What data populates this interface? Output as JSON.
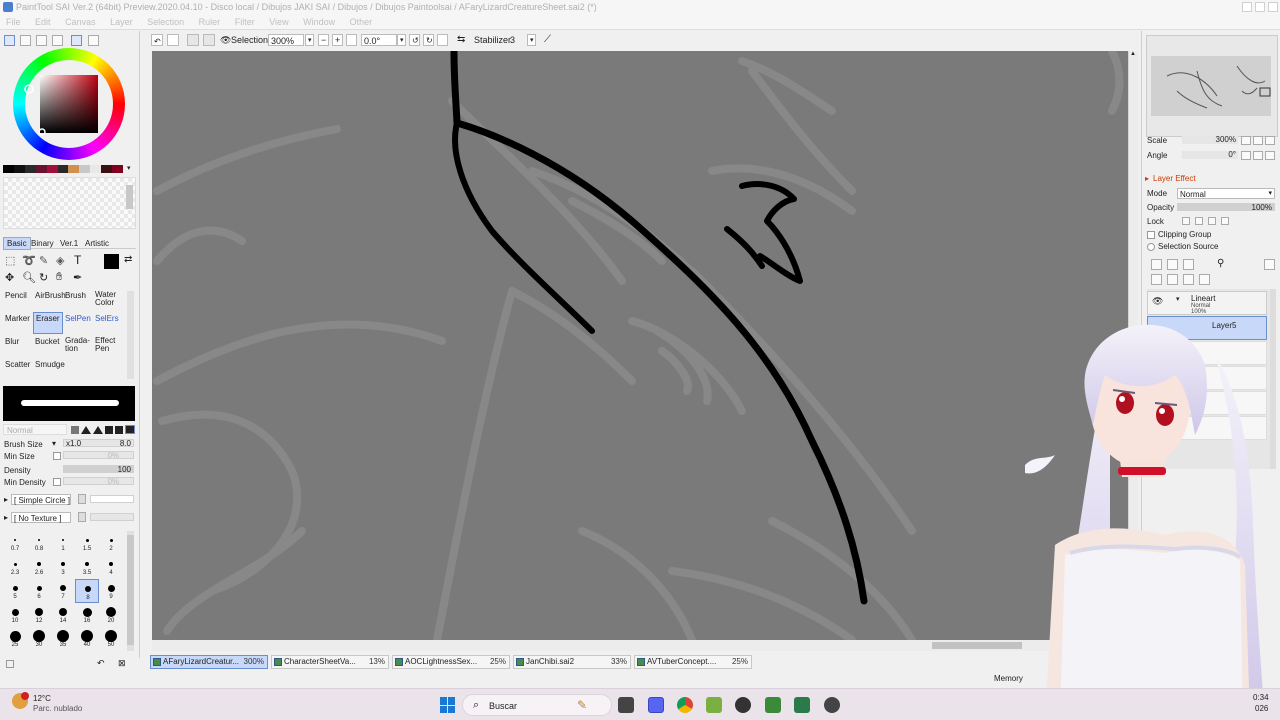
{
  "window": {
    "title": "PaintTool SAI Ver.2 (64bit) Preview.2020.04.10 - Disco local / Dibujos JAKI SAI / Dibujos / Dibujos Paintoolsai / AFaryLizardCreatureSheet.sai2 (*)"
  },
  "menu": [
    "File",
    "Edit",
    "Canvas",
    "Layer",
    "Selection",
    "Ruler",
    "Filter",
    "View",
    "Window",
    "Other"
  ],
  "toolbar": {
    "selection_label": "Selection",
    "zoom": "300%",
    "rotation": "0.0°",
    "stabilizer_label": "Stabilizer",
    "stabilizer_value": "3"
  },
  "left": {
    "tool_tabs": [
      "Basic",
      "Binary",
      "Ver.1",
      "Artistic"
    ],
    "tools": [
      {
        "label": "Pencil"
      },
      {
        "label": "AirBrush"
      },
      {
        "label": "Brush"
      },
      {
        "label": "Water Color"
      },
      {
        "label": "Marker"
      },
      {
        "label": "Eraser"
      },
      {
        "label": "SelPen"
      },
      {
        "label": "SelErs"
      },
      {
        "label": "Blur"
      },
      {
        "label": "Bucket"
      },
      {
        "label": "Grada- tion"
      },
      {
        "label": "Effect Pen"
      },
      {
        "label": "Scatter"
      },
      {
        "label": "Smudge"
      }
    ],
    "blend_mode": "Normal",
    "brush_size_label": "Brush Size",
    "brush_size_multiplier": "x1.0",
    "brush_size_value": "8.0",
    "min_size_label": "Min Size",
    "min_size_value": "0%",
    "density_label": "Density",
    "density_value": "100",
    "min_density_label": "Min Density",
    "min_density_value": "0%",
    "shape": "[ Simple Circle ]",
    "texture": "[ No Texture ]",
    "brush_sizes": [
      "0.7",
      "0.8",
      "1",
      "1.5",
      "2",
      "2.3",
      "2.6",
      "3",
      "3.5",
      "4",
      "5",
      "6",
      "7",
      "8",
      "9",
      "10",
      "12",
      "14",
      "16",
      "20",
      "25",
      "30",
      "35",
      "40",
      "50"
    ]
  },
  "right": {
    "scale_label": "Scale",
    "scale_value": "300%",
    "angle_label": "Angle",
    "angle_value": "0°",
    "layer_effect_label": "Layer Effect",
    "mode_label": "Mode",
    "mode_value": "Normal",
    "opacity_label": "Opacity",
    "opacity_value": "100%",
    "lock_label": "Lock",
    "clipping_group_label": "Clipping Group",
    "selection_source_label": "Selection Source",
    "layers": [
      {
        "name": "Lineart",
        "mode": "Normal",
        "opacity": "100%"
      },
      {
        "name": "Layer5",
        "mode": "",
        "opacity": ""
      }
    ]
  },
  "doc_tabs": [
    {
      "name": "AFaryLizardCreatur...",
      "pct": "300%"
    },
    {
      "name": "CharacterSheetVa...",
      "pct": "13%"
    },
    {
      "name": "AOCLightnessSex...",
      "pct": "25%"
    },
    {
      "name": "JanChibi.sai2",
      "pct": "33%"
    },
    {
      "name": "AVTuberConcept....",
      "pct": "25%"
    }
  ],
  "status": {
    "memory_label": "Memory"
  },
  "taskbar": {
    "temperature": "12°C",
    "weather": "Parc. nublado",
    "search_label": "Buscar",
    "time": "0:34",
    "date": "026"
  },
  "colors": {
    "canvas_bg": "#7a7a7a",
    "panel_bg": "#f0f0f0",
    "selection_blue": "#c8d8f8"
  }
}
